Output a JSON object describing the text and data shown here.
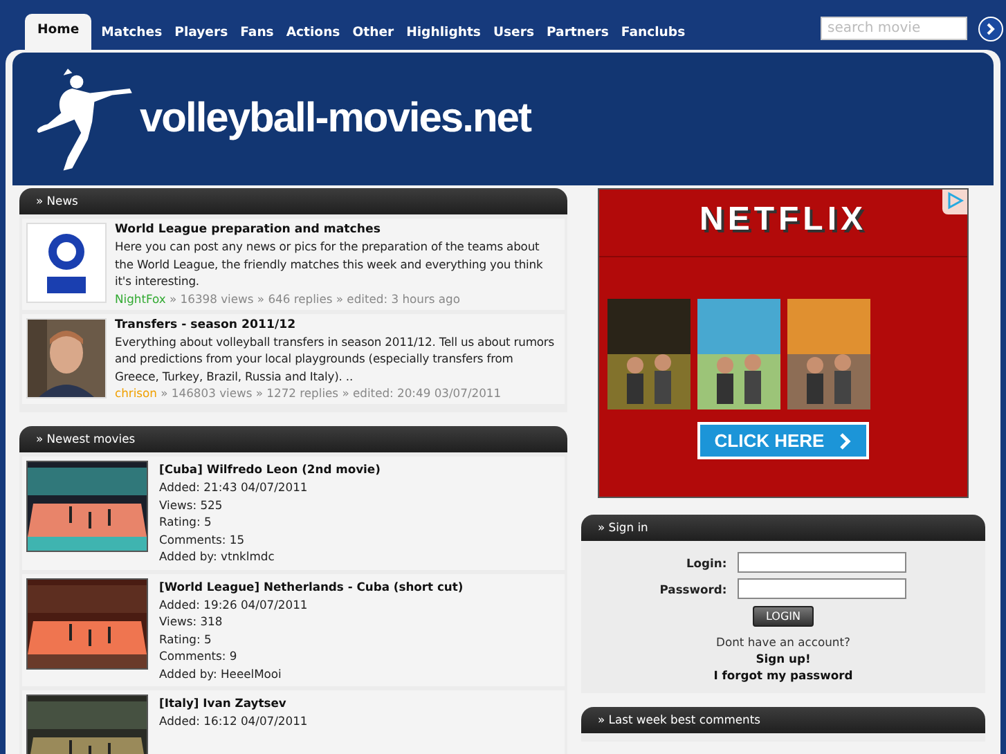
{
  "nav": {
    "tabs": [
      {
        "label": "Home",
        "selected": true
      },
      {
        "label": "Matches",
        "selected": false
      },
      {
        "label": "Players",
        "selected": false
      },
      {
        "label": "Fans",
        "selected": false
      },
      {
        "label": "Actions",
        "selected": false
      },
      {
        "label": "Other",
        "selected": false
      },
      {
        "label": "Highlights",
        "selected": false
      },
      {
        "label": "Users",
        "selected": false
      },
      {
        "label": "Partners",
        "selected": false
      },
      {
        "label": "Fanclubs",
        "selected": false
      }
    ],
    "search": {
      "placeholder": "search movie"
    }
  },
  "header": {
    "site_title": "volleyball-movies.net"
  },
  "news": {
    "title": "» News",
    "items": [
      {
        "title": "World League preparation and matches",
        "text": "Here you can post any news or pics for the preparation of the teams about the World League, the friendly matches this week and everything you think it's interesting.",
        "author": "NightFox",
        "color": "#33aa33",
        "meta": " » 16398 views » 646 replies » edited: 3 hours ago"
      },
      {
        "title": "Transfers - season 2011/12",
        "text": "Everything about volleyball transfers in season 2011/12. Tell us about rumors and predictions from your local playgrounds (especially transfers from Greece, Turkey, Brazil, Russia and Italy). ..",
        "author": "chrison",
        "color": "#f0a000",
        "meta": " » 146803 views » 1272 replies » edited: 20:49 03/07/2011"
      }
    ]
  },
  "movies": {
    "title": "» Newest movies",
    "items": [
      {
        "title": "[Cuba] Wilfredo Leon (2nd movie)",
        "details": [
          "Added: 21:43 04/07/2011",
          "Views: 525",
          "Rating: 5",
          "Comments: 15",
          "Added by: vtnklmdc"
        ]
      },
      {
        "title": "[World League] Netherlands - Cuba (short cut)",
        "details": [
          "Added: 19:26 04/07/2011",
          "Views: 318",
          "Rating: 5",
          "Comments: 9",
          "Added by: HeeelMooi"
        ]
      },
      {
        "title": "[Italy] Ivan Zaytsev",
        "details": [
          "Added: 16:12 04/07/2011"
        ]
      }
    ]
  },
  "ad": {
    "brand": "NETFLIX",
    "cta": "CLICK HERE"
  },
  "signin": {
    "title": "» Sign in",
    "login_label": "Login:",
    "password_label": "Password:",
    "button": "LOGIN",
    "prompt": "Dont have an account?",
    "signup": "Sign up!",
    "forgot": "I forgot my password"
  },
  "comments": {
    "title": "» Last week best comments"
  }
}
